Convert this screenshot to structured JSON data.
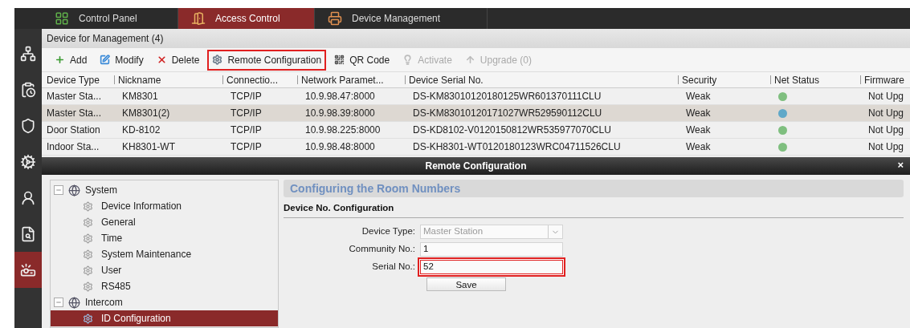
{
  "tabs": [
    {
      "label": "Control Panel",
      "selected": false
    },
    {
      "label": "Access Control",
      "selected": true
    },
    {
      "label": "Device Management",
      "selected": false
    }
  ],
  "rail": [
    {
      "selected": false
    },
    {
      "selected": false
    },
    {
      "selected": false
    },
    {
      "selected": false
    },
    {
      "selected": false
    },
    {
      "selected": false
    },
    {
      "selected": true
    }
  ],
  "panel_title": "Device for Management (4)",
  "toolbar": [
    {
      "label": "Add",
      "disabled": false,
      "highlighted": false
    },
    {
      "label": "Modify",
      "disabled": false,
      "highlighted": false
    },
    {
      "label": "Delete",
      "disabled": false,
      "highlighted": false
    },
    {
      "label": "Remote Configuration",
      "disabled": false,
      "highlighted": true
    },
    {
      "label": "QR Code",
      "disabled": false,
      "highlighted": false
    },
    {
      "label": "Activate",
      "disabled": true,
      "highlighted": false
    },
    {
      "label": "Upgrade (0)",
      "disabled": true,
      "highlighted": false
    }
  ],
  "table": {
    "columns": [
      "Device Type",
      "Nickname",
      "Connectio...",
      "Network Paramet...",
      "Device Serial No.",
      "Security",
      "Net Status",
      "Firmware"
    ],
    "rows": [
      {
        "selected": false,
        "cells": [
          "Master Sta...",
          "KM8301",
          "TCP/IP",
          "10.9.98.47:8000",
          "DS-KM83010120180125WR601370111CLU",
          "Weak",
          "",
          "Not Upg"
        ],
        "color": "#7fbf7f"
      },
      {
        "selected": true,
        "cells": [
          "Master Sta...",
          "KM8301(2)",
          "TCP/IP",
          "10.9.98.39:8000",
          "DS-KM83010120171027WR529590112CLU",
          "Weak",
          "",
          "Not Upg"
        ],
        "color": "#5fa8c8"
      },
      {
        "selected": false,
        "cells": [
          "Door Station",
          "KD-8102",
          "TCP/IP",
          "10.9.98.225:8000",
          "DS-KD8102-V0120150812WR535977070CLU",
          "Weak",
          "",
          "Not Upg"
        ],
        "color": "#7fbf7f"
      },
      {
        "selected": false,
        "cells": [
          "Indoor Sta...",
          "KH8301-WT",
          "TCP/IP",
          "10.9.98.48:8000",
          "DS-KH8301-WT0120180123WRC04711526CLU",
          "Weak",
          "",
          "Not Upg"
        ],
        "color": "#7fbf7f"
      }
    ]
  },
  "dialog": {
    "title": "Remote Configuration",
    "close": "×",
    "tree": [
      {
        "label": "System",
        "expanded": true,
        "selected": false,
        "children": [
          {
            "label": "Device Information",
            "selected": false
          },
          {
            "label": "General",
            "selected": false
          },
          {
            "label": "Time",
            "selected": false
          },
          {
            "label": "System Maintenance",
            "selected": false
          },
          {
            "label": "User",
            "selected": false
          },
          {
            "label": "RS485",
            "selected": false
          }
        ]
      },
      {
        "label": "Intercom",
        "expanded": true,
        "selected": false,
        "children": [
          {
            "label": "ID Configuration",
            "selected": true
          }
        ]
      }
    ],
    "heading": "Configuring the Room Numbers",
    "section": "Device No. Configuration",
    "fields": [
      {
        "kind": "select",
        "label": "Device Type:",
        "value": "Master Station",
        "disabled": true,
        "highlighted": false
      },
      {
        "kind": "text",
        "label": "Community No.:",
        "value": "1",
        "disabled": false,
        "highlighted": false
      },
      {
        "kind": "text",
        "label": "Serial No.:",
        "value": "52",
        "disabled": false,
        "highlighted": true
      }
    ],
    "save": "Save"
  }
}
